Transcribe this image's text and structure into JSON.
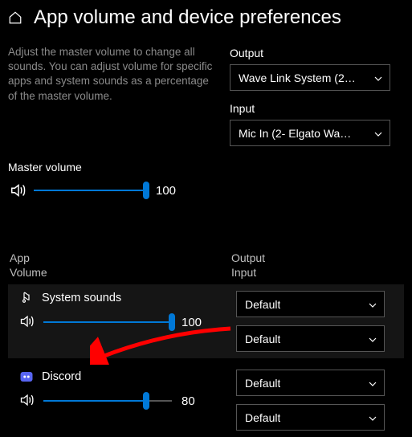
{
  "header": {
    "title": "App volume and device preferences"
  },
  "description": "Adjust the master volume to change all sounds. You can adjust volume for specific apps and system sounds as a percentage of the master volume.",
  "devices": {
    "output_label": "Output",
    "output_value": "Wave Link System (2…",
    "input_label": "Input",
    "input_value": "Mic In (2- Elgato Wa…"
  },
  "master": {
    "label": "Master volume",
    "value": 100,
    "percent": 100
  },
  "columns": {
    "left_line1": "App",
    "left_line2": "Volume",
    "right_line1": "Output",
    "right_line2": "Input"
  },
  "apps": [
    {
      "name": "System sounds",
      "icon": "system-sounds",
      "volume": 100,
      "percent": 100,
      "output": "Default",
      "input": "Default"
    },
    {
      "name": "Discord",
      "icon": "discord",
      "volume": 80,
      "percent": 80,
      "output": "Default",
      "input": "Default"
    }
  ]
}
